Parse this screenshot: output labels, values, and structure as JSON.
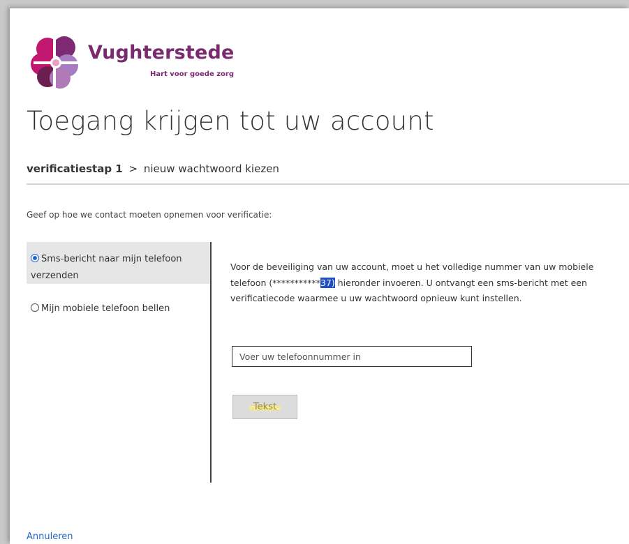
{
  "logo": {
    "name": "Vughterstede",
    "tagline": "Hart voor goede zorg",
    "colors": {
      "magenta": "#c2186f",
      "plum": "#6b1f4f",
      "purple": "#7a2a6e",
      "lilac": "#a77cc1",
      "pink": "#e9a0c4"
    }
  },
  "page_title": "Toegang krijgen tot uw account",
  "steps": {
    "current": "verificatiestap 1",
    "separator": ">",
    "next": "nieuw wachtwoord kiezen"
  },
  "instruction": "Geef op hoe we contact moeten opnemen voor verificatie:",
  "options": [
    {
      "label": "Sms-bericht naar mijn telefoon verzenden",
      "selected": true
    },
    {
      "label": "Mijn mobiele telefoon bellen",
      "selected": false
    }
  ],
  "description": {
    "part1": "Voor de beveiliging van uw account, moet u het volledige nummer van uw mobiele telefoon (",
    "masked": "***********",
    "highlighted": "37)",
    "part2": " hieronder invoeren. U ontvangt een sms-bericht met een verificatiecode waarmee u uw wachtwoord opnieuw kunt instellen."
  },
  "phone_input": {
    "placeholder": "Voer uw telefoonnummer in",
    "value": ""
  },
  "submit_button": "Tekst",
  "cancel_link": "Annuleren",
  "colors": {
    "link": "#2067c9",
    "highlight": "#1e4fc2",
    "divider": "#444444"
  }
}
